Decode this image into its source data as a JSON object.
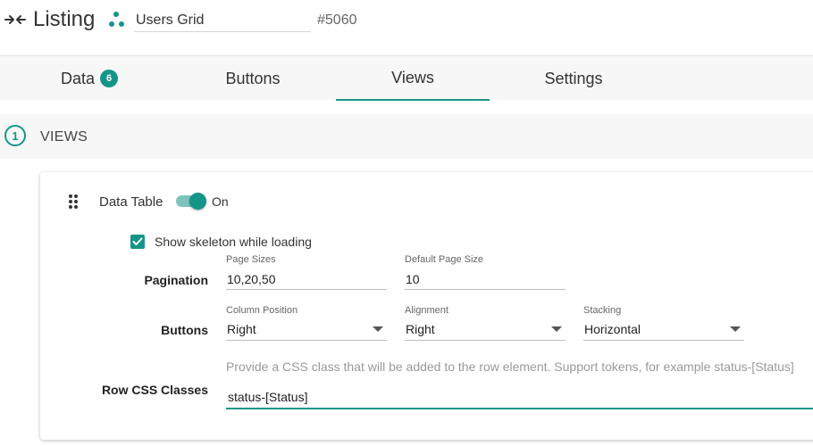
{
  "header": {
    "title": "Listing",
    "name_value": "Users Grid",
    "item_id": "#5060"
  },
  "tabs": [
    {
      "label": "Data",
      "badge": "6",
      "active": false
    },
    {
      "label": "Buttons",
      "active": false
    },
    {
      "label": "Views",
      "active": true
    },
    {
      "label": "Settings",
      "active": false
    }
  ],
  "section": {
    "step": "1",
    "title": "VIEWS"
  },
  "view": {
    "name": "Data Table",
    "toggle_label": "On",
    "enabled": true,
    "skeleton_label": "Show skeleton while loading",
    "skeleton_checked": true,
    "pagination": {
      "label": "Pagination",
      "page_sizes_label": "Page Sizes",
      "page_sizes_value": "10,20,50",
      "default_page_size_label": "Default Page Size",
      "default_page_size_value": "10"
    },
    "buttons": {
      "label": "Buttons",
      "column_position_label": "Column Position",
      "column_position_value": "Right",
      "alignment_label": "Alignment",
      "alignment_value": "Right",
      "stacking_label": "Stacking",
      "stacking_value": "Horizontal"
    },
    "row_css": {
      "label": "Row CSS Classes",
      "hint": "Provide a CSS class that will be added to the row element. Support tokens, for example status-[Status]",
      "value": "status-[Status]"
    }
  },
  "colors": {
    "accent": "#15958a",
    "accent_light": "#7cc4bd",
    "panel_bg": "#f7f7f7"
  },
  "icons": {
    "back": "collapse-arrows-icon",
    "component": "dots-cluster-icon",
    "drag": "drag-handle-icon",
    "check": "check-icon",
    "dropdown": "caret-down-icon"
  }
}
